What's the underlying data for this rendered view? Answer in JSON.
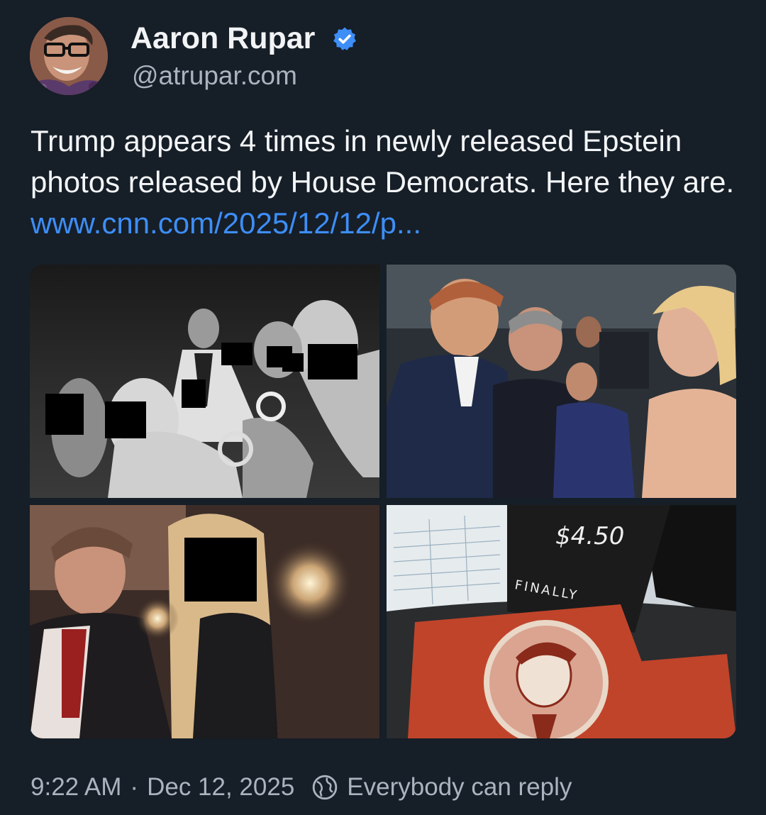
{
  "author": {
    "name": "Aaron Rupar",
    "handle": "@atrupar.com",
    "verified": true
  },
  "post": {
    "text": "Trump appears 4 times in newly released Epstein photos released by House Democrats. Here they are. ",
    "link_text": "www.cnn.com/2025/12/12/p..."
  },
  "media": {
    "count": 4,
    "photos": [
      {
        "id": "photo-1",
        "tone": "black-and-white"
      },
      {
        "id": "photo-2",
        "tone": "color"
      },
      {
        "id": "photo-3",
        "tone": "color"
      },
      {
        "id": "photo-4",
        "tone": "color"
      }
    ],
    "photo4_texts": {
      "price": "$4.50",
      "caption": "FINALLY"
    }
  },
  "footer": {
    "time": "9:22 AM",
    "separator": "·",
    "date": "Dec 12, 2025",
    "reply_setting": "Everybody can reply",
    "globe_icon": "globe-icon"
  },
  "colors": {
    "background": "#161e27",
    "link": "#3d8ef7",
    "secondary_text": "#aab4c0",
    "verified_badge": "#3d8ef7"
  }
}
